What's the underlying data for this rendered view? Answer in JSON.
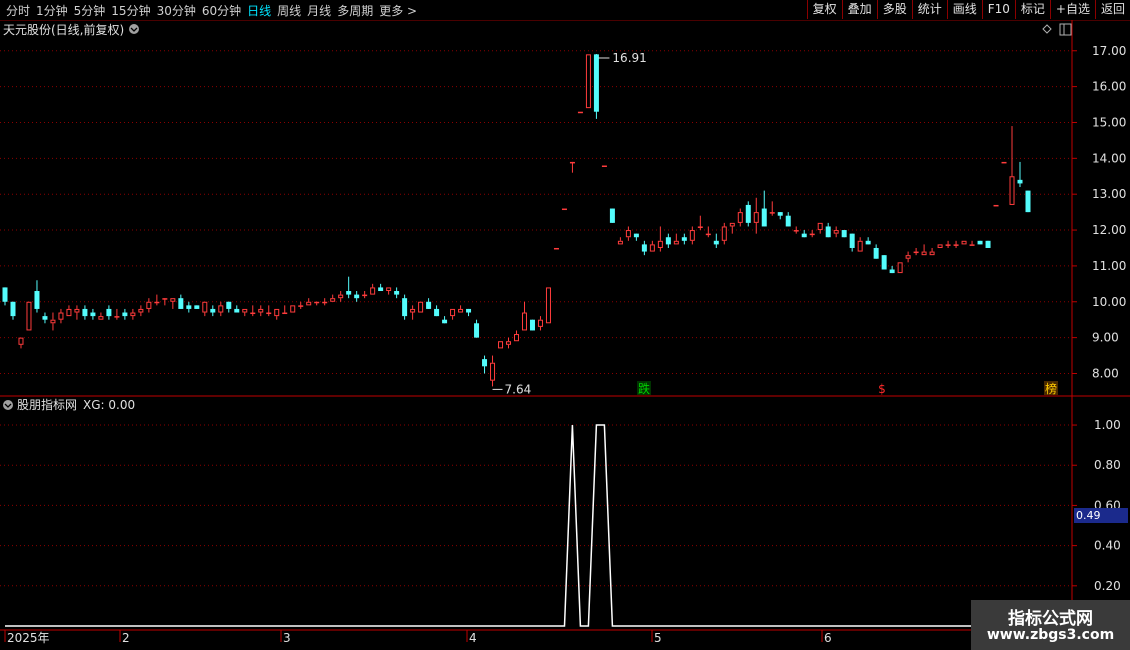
{
  "toolbar": {
    "left_items": [
      "分时",
      "1分钟",
      "5分钟",
      "15分钟",
      "30分钟",
      "60分钟",
      "日线",
      "周线",
      "月线",
      "多周期",
      "更多 >"
    ],
    "selected_index": 6,
    "right_items": [
      "复权",
      "叠加",
      "多股",
      "统计",
      "画线",
      "F10",
      "标记",
      "+自选",
      "返回"
    ]
  },
  "main_panel": {
    "title": "天元股份(日线,前复权)",
    "price_axis": [
      "17.00",
      "16.00",
      "15.00",
      "14.00",
      "13.00",
      "12.00",
      "11.00",
      "10.00",
      "9.00",
      "8.00"
    ],
    "high_label": "16.91",
    "low_label": "7.64",
    "markers": [
      {
        "text": "跌",
        "color": "#00d000",
        "bg": "#003300"
      },
      {
        "text": "$",
        "color": "#ff2a2a",
        "bg": ""
      },
      {
        "text": "榜",
        "color": "#ffcc00",
        "bg": "#4a2a00"
      }
    ]
  },
  "indicator_panel": {
    "title": "股朋指标网",
    "value_label": "XG: 0.00",
    "axis": [
      "1.00",
      "0.80",
      "0.60",
      "0.40",
      "0.20"
    ],
    "cursor_value": "0.49"
  },
  "time_axis": [
    "2025年",
    "2",
    "3",
    "4",
    "5",
    "6"
  ],
  "watermark": {
    "line1": "指标公式网",
    "line2": "www.zbgs3.com"
  },
  "colors": {
    "up": "#ff3c3c",
    "down": "#54fcfc",
    "grid": "#8b0000",
    "axis": "#c00000"
  },
  "chart_data": {
    "type": "candlestick",
    "ohlc": [
      [
        10.4,
        10.4,
        9.9,
        10.0
      ],
      [
        10.0,
        10.0,
        9.5,
        9.6
      ],
      [
        8.8,
        9.0,
        8.7,
        9.0
      ],
      [
        9.2,
        10.0,
        9.2,
        10.0
      ],
      [
        10.3,
        10.6,
        9.7,
        9.8
      ],
      [
        9.6,
        9.7,
        9.4,
        9.5
      ],
      [
        9.4,
        9.7,
        9.2,
        9.5
      ],
      [
        9.5,
        9.8,
        9.4,
        9.7
      ],
      [
        9.6,
        9.9,
        9.6,
        9.8
      ],
      [
        9.7,
        9.9,
        9.5,
        9.8
      ],
      [
        9.8,
        9.9,
        9.5,
        9.6
      ],
      [
        9.7,
        9.8,
        9.5,
        9.6
      ],
      [
        9.5,
        9.7,
        9.5,
        9.6
      ],
      [
        9.8,
        9.9,
        9.5,
        9.6
      ],
      [
        9.6,
        9.8,
        9.5,
        9.6
      ],
      [
        9.7,
        9.8,
        9.5,
        9.6
      ],
      [
        9.6,
        9.8,
        9.5,
        9.7
      ],
      [
        9.7,
        9.9,
        9.6,
        9.8
      ],
      [
        9.8,
        10.1,
        9.7,
        10.0
      ],
      [
        10.0,
        10.2,
        9.9,
        10.0
      ],
      [
        10.1,
        10.1,
        9.9,
        10.1
      ],
      [
        10.0,
        10.1,
        9.8,
        10.1
      ],
      [
        10.1,
        10.2,
        9.8,
        9.8
      ],
      [
        9.9,
        10.0,
        9.7,
        9.8
      ],
      [
        9.9,
        9.9,
        9.8,
        9.8
      ],
      [
        9.7,
        10.0,
        9.6,
        10.0
      ],
      [
        9.8,
        9.9,
        9.6,
        9.7
      ],
      [
        9.7,
        10.0,
        9.6,
        9.9
      ],
      [
        10.0,
        10.0,
        9.7,
        9.8
      ],
      [
        9.8,
        9.9,
        9.7,
        9.7
      ],
      [
        9.7,
        9.8,
        9.6,
        9.8
      ],
      [
        9.7,
        9.9,
        9.6,
        9.7
      ],
      [
        9.7,
        9.9,
        9.6,
        9.8
      ],
      [
        9.7,
        9.9,
        9.6,
        9.7
      ],
      [
        9.6,
        9.8,
        9.5,
        9.8
      ],
      [
        9.7,
        9.9,
        9.7,
        9.7
      ],
      [
        9.7,
        9.9,
        9.7,
        9.9
      ],
      [
        9.9,
        10.0,
        9.8,
        9.9
      ],
      [
        9.9,
        10.1,
        9.9,
        10.0
      ],
      [
        10.0,
        10.0,
        9.9,
        10.0
      ],
      [
        10.0,
        10.1,
        9.9,
        10.0
      ],
      [
        10.0,
        10.2,
        10.0,
        10.1
      ],
      [
        10.1,
        10.3,
        10.0,
        10.2
      ],
      [
        10.3,
        10.7,
        10.1,
        10.2
      ],
      [
        10.2,
        10.3,
        10.0,
        10.1
      ],
      [
        10.2,
        10.3,
        10.1,
        10.2
      ],
      [
        10.2,
        10.5,
        10.2,
        10.4
      ],
      [
        10.4,
        10.5,
        10.3,
        10.3
      ],
      [
        10.3,
        10.4,
        10.2,
        10.4
      ],
      [
        10.3,
        10.4,
        10.1,
        10.2
      ],
      [
        10.1,
        10.2,
        9.5,
        9.6
      ],
      [
        9.7,
        9.9,
        9.5,
        9.8
      ],
      [
        9.7,
        10.0,
        9.7,
        10.0
      ],
      [
        10.0,
        10.1,
        9.8,
        9.8
      ],
      [
        9.8,
        9.9,
        9.6,
        9.6
      ],
      [
        9.5,
        9.6,
        9.4,
        9.4
      ],
      [
        9.6,
        9.8,
        9.5,
        9.8
      ],
      [
        9.7,
        9.9,
        9.7,
        9.8
      ],
      [
        9.8,
        9.8,
        9.6,
        9.7
      ],
      [
        9.4,
        9.5,
        9.0,
        9.0
      ],
      [
        8.4,
        8.5,
        8.0,
        8.2
      ],
      [
        7.8,
        8.5,
        7.64,
        8.3
      ],
      [
        8.7,
        8.9,
        8.7,
        8.9
      ],
      [
        8.8,
        9.0,
        8.7,
        8.9
      ],
      [
        8.9,
        9.2,
        8.9,
        9.1
      ],
      [
        9.2,
        10.0,
        9.2,
        9.7
      ],
      [
        9.5,
        9.5,
        9.2,
        9.2
      ],
      [
        9.3,
        9.6,
        9.2,
        9.5
      ],
      [
        9.4,
        10.4,
        9.4,
        10.4
      ],
      [
        11.5,
        11.5,
        11.5,
        11.5
      ],
      [
        12.6,
        12.6,
        12.6,
        12.6
      ],
      [
        13.9,
        13.9,
        13.6,
        13.9
      ],
      [
        15.3,
        15.3,
        15.3,
        15.3
      ],
      [
        15.4,
        16.9,
        15.4,
        16.9
      ],
      [
        16.9,
        16.91,
        15.1,
        15.3
      ],
      [
        13.8,
        13.8,
        13.8,
        13.8
      ],
      [
        12.6,
        12.6,
        12.2,
        12.2
      ],
      [
        11.6,
        11.8,
        11.6,
        11.7
      ],
      [
        11.8,
        12.1,
        11.7,
        12.0
      ],
      [
        11.9,
        11.9,
        11.7,
        11.8
      ],
      [
        11.6,
        11.7,
        11.3,
        11.4
      ],
      [
        11.4,
        11.7,
        11.4,
        11.6
      ],
      [
        11.5,
        12.1,
        11.4,
        11.7
      ],
      [
        11.8,
        11.9,
        11.5,
        11.6
      ],
      [
        11.6,
        11.9,
        11.6,
        11.7
      ],
      [
        11.8,
        11.9,
        11.6,
        11.7
      ],
      [
        11.7,
        12.1,
        11.6,
        12.0
      ],
      [
        12.1,
        12.4,
        12.0,
        12.1
      ],
      [
        11.9,
        12.1,
        11.8,
        11.9
      ],
      [
        11.7,
        11.9,
        11.5,
        11.6
      ],
      [
        11.7,
        12.2,
        11.6,
        12.1
      ],
      [
        12.1,
        12.2,
        11.9,
        12.2
      ],
      [
        12.2,
        12.6,
        12.1,
        12.5
      ],
      [
        12.7,
        12.8,
        12.1,
        12.2
      ],
      [
        12.2,
        12.9,
        11.9,
        12.5
      ],
      [
        12.6,
        13.1,
        12.1,
        12.1
      ],
      [
        12.5,
        12.8,
        12.4,
        12.5
      ],
      [
        12.5,
        12.5,
        12.3,
        12.4
      ],
      [
        12.4,
        12.5,
        12.1,
        12.1
      ],
      [
        12.0,
        12.1,
        11.9,
        12.0
      ],
      [
        11.9,
        12.0,
        11.8,
        11.8
      ],
      [
        11.9,
        12.0,
        11.8,
        11.9
      ],
      [
        12.0,
        12.2,
        11.9,
        12.2
      ],
      [
        12.1,
        12.2,
        11.8,
        11.8
      ],
      [
        11.9,
        12.1,
        11.8,
        12.0
      ],
      [
        12.0,
        12.0,
        11.8,
        11.8
      ],
      [
        11.9,
        11.9,
        11.4,
        11.5
      ],
      [
        11.4,
        11.8,
        11.4,
        11.7
      ],
      [
        11.7,
        11.8,
        11.6,
        11.6
      ],
      [
        11.5,
        11.6,
        11.2,
        11.2
      ],
      [
        11.3,
        11.3,
        10.9,
        10.9
      ],
      [
        10.9,
        11.0,
        10.8,
        10.8
      ],
      [
        10.8,
        11.1,
        10.8,
        11.1
      ],
      [
        11.2,
        11.4,
        11.1,
        11.3
      ],
      [
        11.4,
        11.5,
        11.3,
        11.4
      ],
      [
        11.3,
        11.6,
        11.3,
        11.4
      ],
      [
        11.3,
        11.5,
        11.3,
        11.4
      ],
      [
        11.5,
        11.6,
        11.5,
        11.6
      ],
      [
        11.6,
        11.7,
        11.5,
        11.6
      ],
      [
        11.6,
        11.7,
        11.5,
        11.6
      ],
      [
        11.6,
        11.7,
        11.6,
        11.7
      ],
      [
        11.6,
        11.7,
        11.6,
        11.6
      ],
      [
        11.7,
        11.7,
        11.6,
        11.6
      ],
      [
        11.7,
        11.7,
        11.5,
        11.5
      ],
      [
        12.7,
        12.7,
        12.7,
        12.7
      ],
      [
        13.9,
        13.9,
        13.9,
        13.9
      ],
      [
        12.7,
        14.9,
        12.7,
        13.5
      ],
      [
        13.4,
        13.9,
        13.2,
        13.3
      ],
      [
        13.1,
        13.1,
        12.5,
        12.5
      ]
    ],
    "xg": [
      0,
      0,
      0,
      0,
      0,
      0,
      0,
      0,
      0,
      0,
      0,
      0,
      0,
      0,
      0,
      0,
      0,
      0,
      0,
      0,
      0,
      0,
      0,
      0,
      0,
      0,
      0,
      0,
      0,
      0,
      0,
      0,
      0,
      0,
      0,
      0,
      0,
      0,
      0,
      0,
      0,
      0,
      0,
      0,
      0,
      0,
      0,
      0,
      0,
      0,
      0,
      0,
      0,
      0,
      0,
      0,
      0,
      0,
      0,
      0,
      0,
      0,
      0,
      0,
      0,
      0,
      0,
      0,
      0,
      0,
      0,
      1,
      0,
      0,
      1,
      1,
      0,
      0,
      0,
      0,
      0,
      0,
      0,
      0,
      0,
      0,
      0,
      0,
      0,
      0,
      0,
      0,
      0,
      0,
      0,
      0,
      0,
      0,
      0,
      0,
      0,
      0,
      0,
      0,
      0,
      0,
      0,
      0,
      0,
      0,
      0,
      0,
      0,
      0,
      0,
      0,
      0,
      0,
      0,
      0,
      0,
      0,
      0,
      0,
      0,
      0,
      0,
      0,
      0
    ],
    "price_range": [
      7.4,
      17.3
    ],
    "indicator_range": [
      0,
      1.05
    ]
  }
}
